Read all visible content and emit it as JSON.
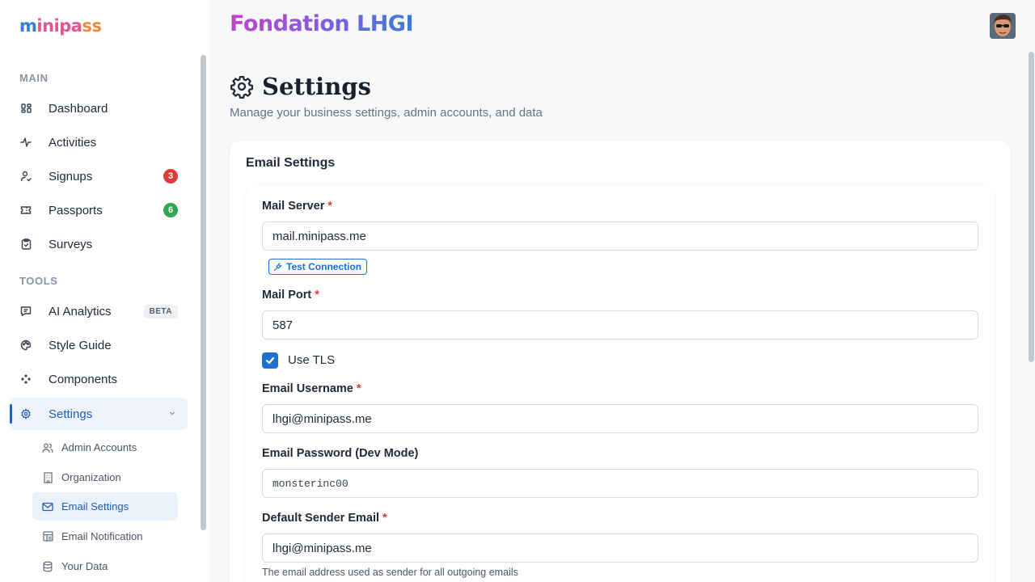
{
  "brand": {
    "logo_part1": "m",
    "logo_part2": "inipa",
    "logo_part3": "ss"
  },
  "sidebar": {
    "section_main": "MAIN",
    "section_tools": "TOOLS",
    "items": [
      {
        "label": "Dashboard",
        "icon": "grid-icon"
      },
      {
        "label": "Activities",
        "icon": "activity-icon"
      },
      {
        "label": "Signups",
        "icon": "user-icon",
        "badge": "3"
      },
      {
        "label": "Passports",
        "icon": "ticket-icon",
        "badge": "6"
      },
      {
        "label": "Surveys",
        "icon": "clipboard-icon"
      },
      {
        "label": "AI Analytics",
        "icon": "chat-icon",
        "tag": "BETA"
      },
      {
        "label": "Style Guide",
        "icon": "palette-icon"
      },
      {
        "label": "Components",
        "icon": "components-icon"
      },
      {
        "label": "Settings",
        "icon": "gear-icon"
      }
    ],
    "sub_items": [
      {
        "label": "Admin Accounts",
        "icon": "users-icon"
      },
      {
        "label": "Organization",
        "icon": "building-icon"
      },
      {
        "label": "Email Settings",
        "icon": "mail-icon"
      },
      {
        "label": "Email Notification",
        "icon": "template-icon"
      },
      {
        "label": "Your Data",
        "icon": "database-icon"
      }
    ]
  },
  "header": {
    "org_name": "Fondation LHGI"
  },
  "page": {
    "title": "Settings",
    "subtitle": "Manage your business settings, admin accounts, and data"
  },
  "email_settings": {
    "card_title": "Email Settings",
    "mail_server_label": "Mail Server",
    "mail_server_value": "mail.minipass.me",
    "test_connection_label": "Test Connection",
    "mail_port_label": "Mail Port",
    "mail_port_value": "587",
    "use_tls_label": "Use TLS",
    "use_tls_checked": true,
    "username_label": "Email Username",
    "username_value": "lhgi@minipass.me",
    "password_label": "Email Password (Dev Mode)",
    "password_value": "monsterinc00",
    "sender_label": "Default Sender Email",
    "sender_value": "lhgi@minipass.me",
    "sender_help": "The email address used as sender for all outgoing emails",
    "required_mark": "*"
  },
  "colors": {
    "accent": "#1e6fd0",
    "required": "#e03a3a",
    "badge_red": "#e03a3a",
    "badge_green": "#2fa84f"
  }
}
